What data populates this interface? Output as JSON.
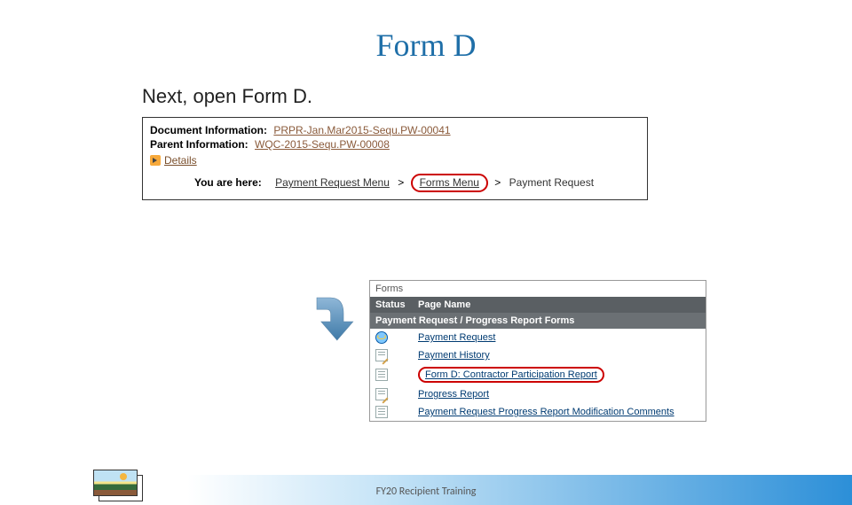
{
  "title": "Form D",
  "subtitle": "Next, open Form D.",
  "info": {
    "doc_label": "Document Information:",
    "doc_link": "PRPR-Jan.Mar2015-Sequ.PW-00041",
    "parent_label": "Parent Information:",
    "parent_link": "WQC-2015-Sequ.PW-00008",
    "details": "Details"
  },
  "breadcrumb": {
    "label": "You are here:",
    "first": "Payment Request Menu",
    "sep": ">",
    "second": "Forms Menu",
    "third": "Payment Request"
  },
  "forms": {
    "title": "Forms",
    "col_status": "Status",
    "col_page": "Page Name",
    "section": "Payment Request / Progress Report Forms",
    "rows": [
      {
        "label": "Payment Request"
      },
      {
        "label": "Payment History"
      },
      {
        "label": "Form D: Contractor Participation Report"
      },
      {
        "label": "Progress Report"
      },
      {
        "label": "Payment Request Progress Report Modification Comments"
      }
    ]
  },
  "footer": "FY20 Recipient Training"
}
